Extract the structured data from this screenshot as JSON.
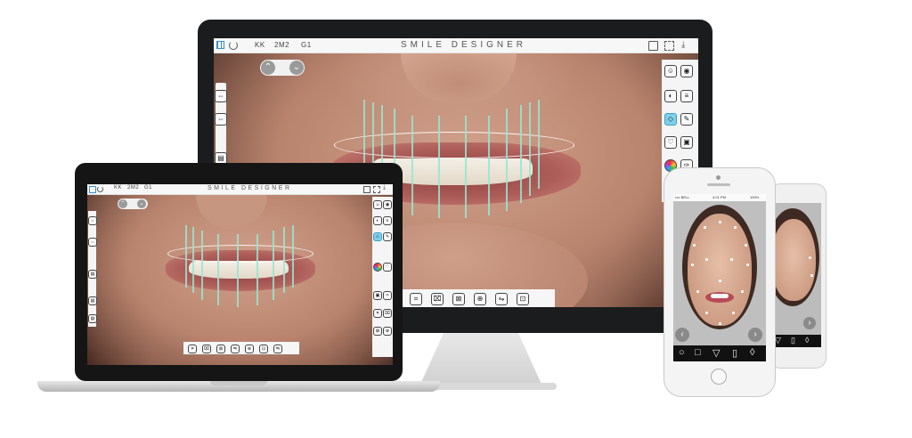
{
  "app": {
    "title": "SMILE DESIGNER",
    "nav_items": [
      "KK",
      "2M2",
      "G1"
    ]
  },
  "toolbar_icons": [
    "grid-icon",
    "refresh-icon",
    "save-icon",
    "fullscreen-icon",
    "download-icon"
  ],
  "phone": {
    "status_carrier": "•••• BELL",
    "status_time": "4:21 PM",
    "status_battery": "100%",
    "nav_prev": "‹",
    "nav_next": "›",
    "shape_buttons": [
      "○",
      "□",
      "▽",
      "▯",
      "◊"
    ]
  },
  "colors": {
    "guide_lines": "#96e6d2",
    "highlight_tool": "#7fd0ec",
    "bezel": "#1b1c1e"
  }
}
